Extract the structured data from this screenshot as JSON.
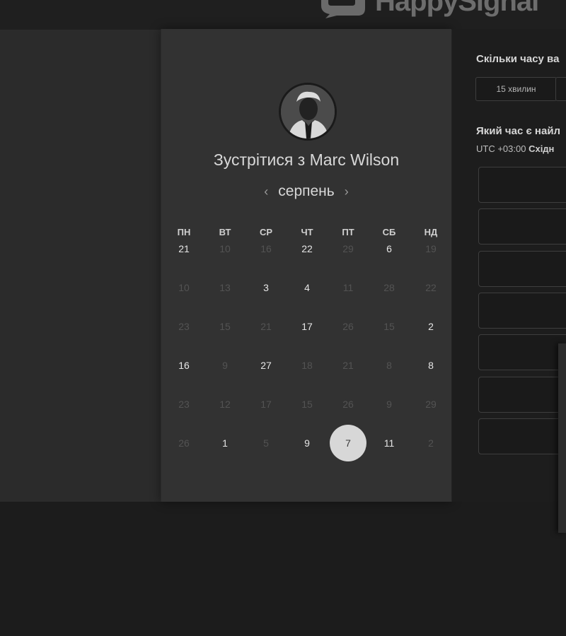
{
  "brand": {
    "logo_text": "HappySignal"
  },
  "scheduler": {
    "title": "Зустрітися з Marc Wilson",
    "month": "серпень",
    "prev_icon": "chevron-left-icon",
    "next_icon": "chevron-right-icon",
    "weekdays": [
      "ПН",
      "ВТ",
      "СР",
      "ЧТ",
      "ПТ",
      "СБ",
      "НД"
    ],
    "weeks": [
      [
        {
          "d": "21",
          "on": true
        },
        {
          "d": "10",
          "on": false
        },
        {
          "d": "16",
          "on": false
        },
        {
          "d": "22",
          "on": true
        },
        {
          "d": "29",
          "on": false
        },
        {
          "d": "6",
          "on": true
        },
        {
          "d": "19",
          "on": false
        }
      ],
      [
        {
          "d": "10",
          "on": false
        },
        {
          "d": "13",
          "on": false
        },
        {
          "d": "3",
          "on": true
        },
        {
          "d": "4",
          "on": true
        },
        {
          "d": "11",
          "on": false
        },
        {
          "d": "28",
          "on": false
        },
        {
          "d": "22",
          "on": false
        }
      ],
      [
        {
          "d": "23",
          "on": false
        },
        {
          "d": "15",
          "on": false
        },
        {
          "d": "21",
          "on": false
        },
        {
          "d": "17",
          "on": true
        },
        {
          "d": "26",
          "on": false
        },
        {
          "d": "15",
          "on": false
        },
        {
          "d": "2",
          "on": true
        }
      ],
      [
        {
          "d": "16",
          "on": true
        },
        {
          "d": "9",
          "on": false
        },
        {
          "d": "27",
          "on": true
        },
        {
          "d": "18",
          "on": false
        },
        {
          "d": "21",
          "on": false
        },
        {
          "d": "8",
          "on": false
        },
        {
          "d": "8",
          "on": true
        }
      ],
      [
        {
          "d": "23",
          "on": false
        },
        {
          "d": "12",
          "on": false
        },
        {
          "d": "17",
          "on": false
        },
        {
          "d": "15",
          "on": false
        },
        {
          "d": "26",
          "on": false
        },
        {
          "d": "9",
          "on": false
        },
        {
          "d": "29",
          "on": false
        }
      ],
      [
        {
          "d": "26",
          "on": false
        },
        {
          "d": "1",
          "on": true
        },
        {
          "d": "5",
          "on": false
        },
        {
          "d": "9",
          "on": true
        },
        {
          "d": "7",
          "on": true,
          "selected": true
        },
        {
          "d": "11",
          "on": true
        },
        {
          "d": "2",
          "on": false
        }
      ]
    ]
  },
  "booking": {
    "duration_question": "Скільки часу ва",
    "duration_option": "15 хвилин",
    "time_question": "Який час є найл",
    "timezone_prefix": "UTC +03:00",
    "timezone_name": "Східн",
    "slots_count_visible": 7
  }
}
